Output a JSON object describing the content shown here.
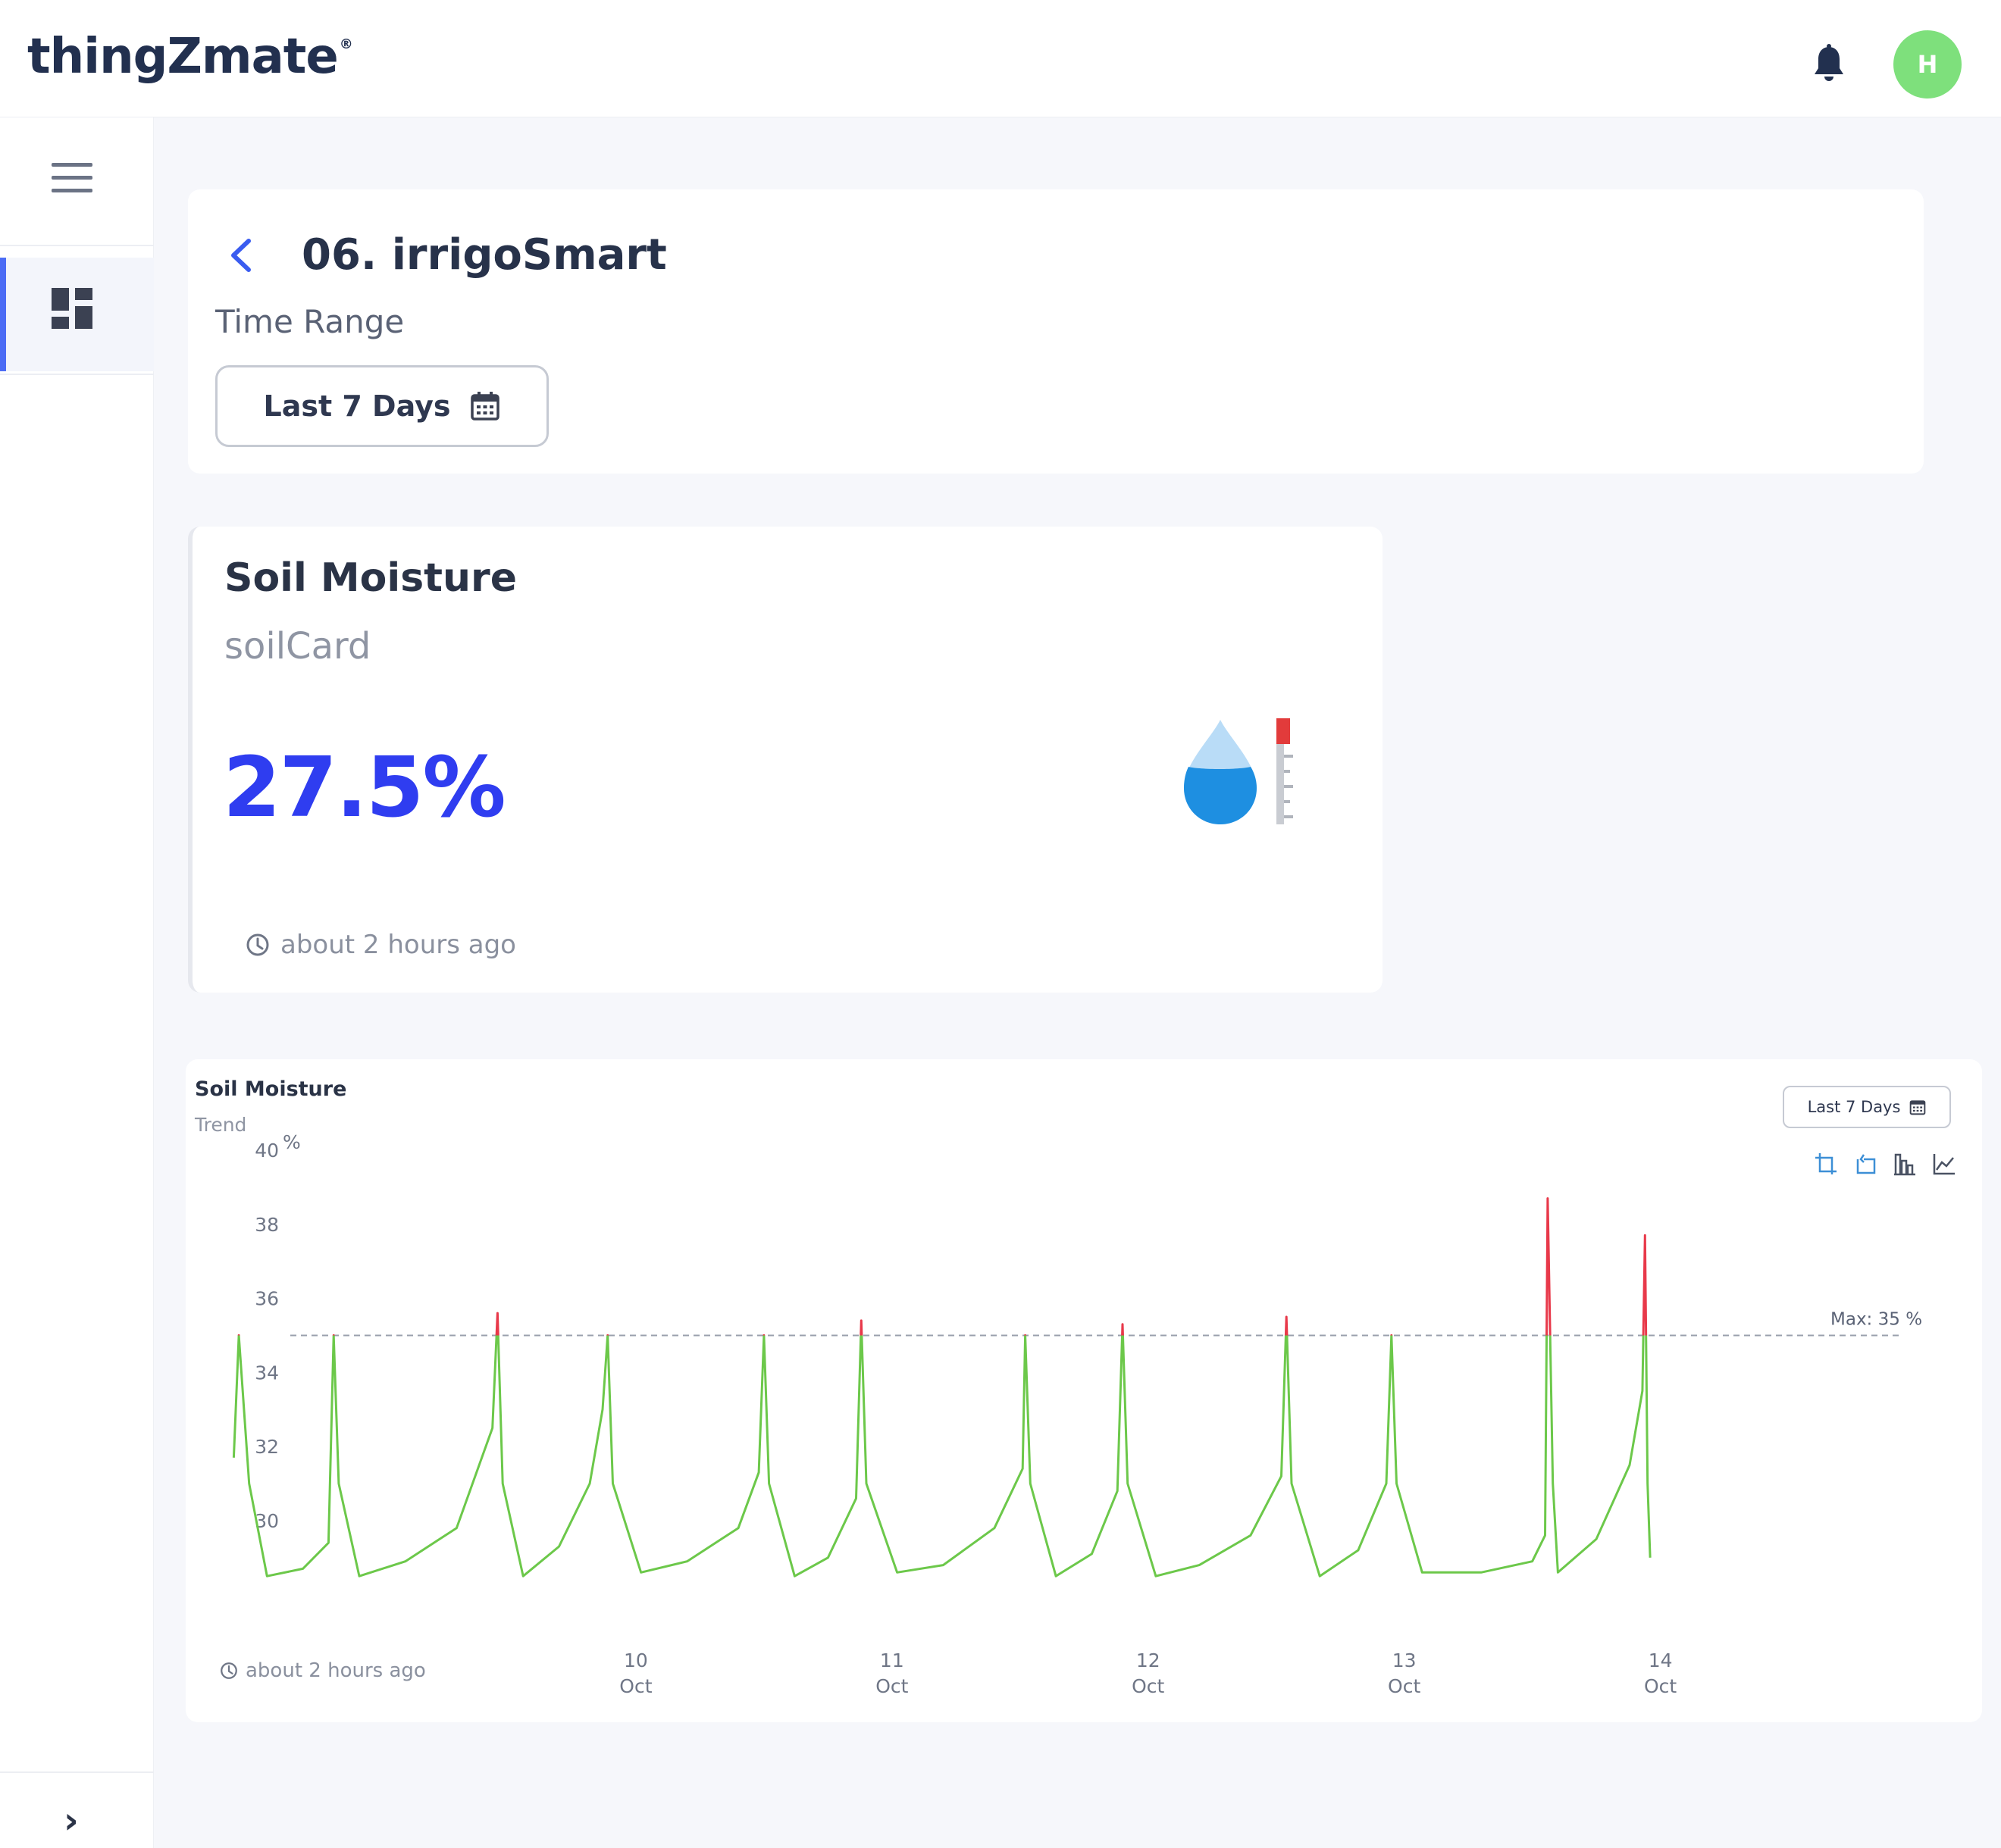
{
  "app": {
    "brand": "thingZmate",
    "brand_mark": "®",
    "avatar_initial": "H"
  },
  "header": {
    "title": "06. irrigoSmart",
    "time_range_label": "Time Range",
    "time_range_value": "Last 7 Days"
  },
  "value_card": {
    "title": "Soil Moisture",
    "subtitle": "soilCard",
    "value": "27.5%",
    "updated": "about 2 hours ago"
  },
  "chart_card": {
    "title": "Soil Moisture",
    "subtitle": "Trend",
    "range_button": "Last 7 Days",
    "updated": "about 2 hours ago",
    "max_label": "Max:  35 %"
  },
  "colors": {
    "accent": "#2f3df0",
    "sidebar_active": "#4c6cf5",
    "avatar": "#7ee07c",
    "line_normal": "#6cc84a",
    "line_above_max": "#e8394a",
    "toolbox": "#3d8fd6"
  },
  "icons": {
    "notification": "bell-icon",
    "menu": "hamburger-icon",
    "dashboard": "dashboard-icon",
    "back": "chevron-left-icon",
    "calendar": "calendar-icon",
    "moisture": "water-drop-gauge-icon",
    "clock": "clock-icon",
    "expand": "chevron-right-icon"
  },
  "chart_data": {
    "type": "line",
    "title": "Soil Moisture",
    "subtitle": "Trend",
    "unit": "%",
    "ylim": [
      26.5,
      40
    ],
    "y_ticks": [
      30,
      32,
      34,
      36,
      38,
      40
    ],
    "x_ticks": [
      {
        "day": "10",
        "month": "Oct",
        "pos": 1.0
      },
      {
        "day": "11",
        "month": "Oct",
        "pos": 2.0
      },
      {
        "day": "12",
        "month": "Oct",
        "pos": 3.0
      },
      {
        "day": "13",
        "month": "Oct",
        "pos": 4.0
      },
      {
        "day": "14",
        "month": "Oct",
        "pos": 5.0
      }
    ],
    "x_range": [
      -0.58,
      5.96
    ],
    "mark_line": {
      "name": "Max",
      "value": 35
    },
    "series": [
      {
        "values": [
          [
            -0.57,
            31.7
          ],
          [
            -0.55,
            35.0
          ],
          [
            -0.51,
            31.0
          ],
          [
            -0.44,
            28.5
          ],
          [
            -0.3,
            28.7
          ],
          [
            -0.2,
            29.4
          ],
          [
            -0.18,
            35.0
          ],
          [
            -0.16,
            31.0
          ],
          [
            -0.08,
            28.5
          ],
          [
            0.1,
            28.9
          ],
          [
            0.3,
            29.8
          ],
          [
            0.44,
            32.5
          ],
          [
            0.46,
            35.6
          ],
          [
            0.48,
            31.0
          ],
          [
            0.56,
            28.5
          ],
          [
            0.7,
            29.3
          ],
          [
            0.82,
            31.0
          ],
          [
            0.87,
            33.0
          ],
          [
            0.89,
            35.0
          ],
          [
            0.91,
            31.0
          ],
          [
            1.02,
            28.6
          ],
          [
            1.2,
            28.9
          ],
          [
            1.4,
            29.8
          ],
          [
            1.48,
            31.3
          ],
          [
            1.5,
            35.0
          ],
          [
            1.52,
            31.0
          ],
          [
            1.62,
            28.5
          ],
          [
            1.75,
            29.0
          ],
          [
            1.86,
            30.6
          ],
          [
            1.88,
            35.4
          ],
          [
            1.9,
            31.0
          ],
          [
            2.02,
            28.6
          ],
          [
            2.2,
            28.8
          ],
          [
            2.4,
            29.8
          ],
          [
            2.51,
            31.4
          ],
          [
            2.52,
            35.0
          ],
          [
            2.54,
            31.0
          ],
          [
            2.64,
            28.5
          ],
          [
            2.78,
            29.1
          ],
          [
            2.88,
            30.8
          ],
          [
            2.9,
            35.3
          ],
          [
            2.92,
            31.0
          ],
          [
            3.03,
            28.5
          ],
          [
            3.2,
            28.8
          ],
          [
            3.4,
            29.6
          ],
          [
            3.52,
            31.2
          ],
          [
            3.54,
            35.5
          ],
          [
            3.56,
            31.0
          ],
          [
            3.67,
            28.5
          ],
          [
            3.82,
            29.2
          ],
          [
            3.93,
            31.0
          ],
          [
            3.95,
            35.0
          ],
          [
            3.97,
            31.0
          ],
          [
            4.07,
            28.6
          ],
          [
            4.3,
            28.6
          ],
          [
            4.5,
            28.9
          ],
          [
            4.55,
            29.6
          ],
          [
            4.56,
            38.7
          ],
          [
            4.58,
            31.0
          ],
          [
            4.6,
            28.6
          ],
          [
            4.75,
            29.5
          ],
          [
            4.88,
            31.5
          ],
          [
            4.93,
            33.5
          ],
          [
            4.94,
            37.7
          ],
          [
            4.95,
            31.0
          ],
          [
            4.96,
            29.0
          ]
        ]
      }
    ]
  }
}
